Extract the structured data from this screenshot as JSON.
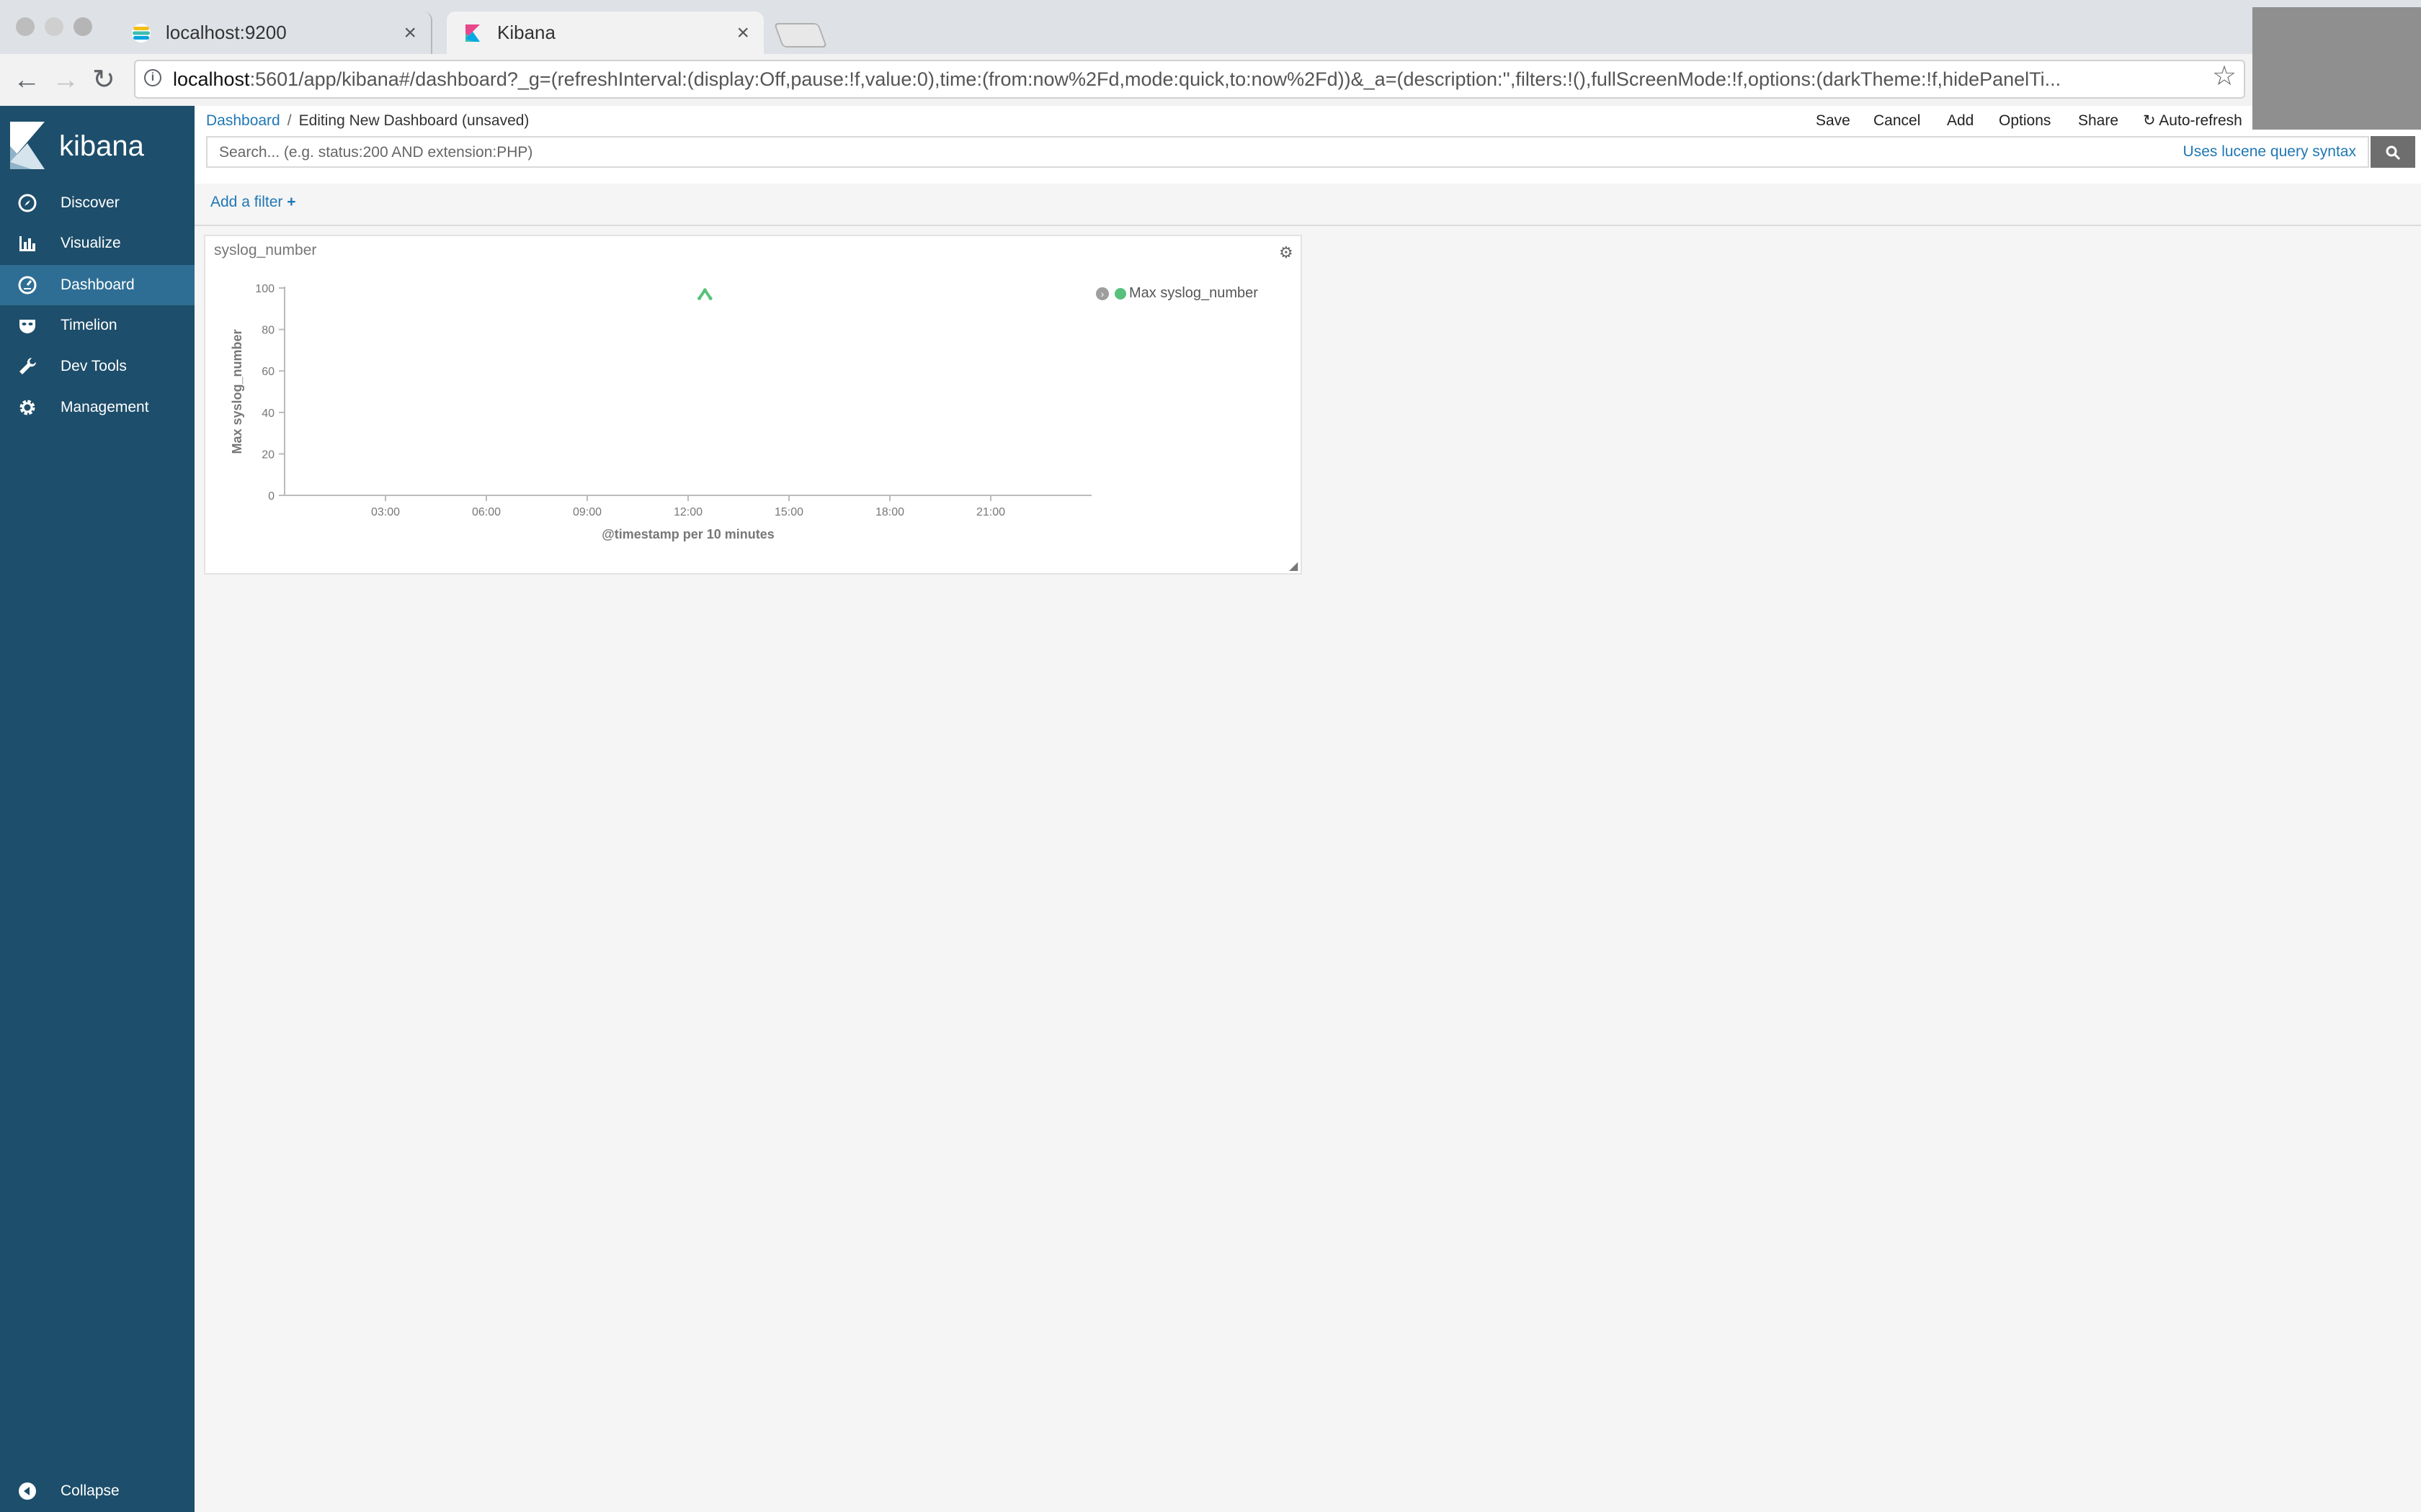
{
  "browser": {
    "tabs": [
      {
        "title": "localhost:9200",
        "active": false
      },
      {
        "title": "Kibana",
        "active": true
      }
    ],
    "url_host": "localhost",
    "url_rest": ":5601/app/kibana#/dashboard?_g=(refreshInterval:(display:Off,pause:!f,value:0),time:(from:now%2Fd,mode:quick,to:now%2Fd))&_a=(description:'',filters:!(),fullScreenMode:!f,options:(darkTheme:!f,hidePanelTi..."
  },
  "sidebar": {
    "brand": "kibana",
    "items": [
      {
        "label": "Discover",
        "icon": "compass-icon"
      },
      {
        "label": "Visualize",
        "icon": "bar-chart-icon"
      },
      {
        "label": "Dashboard",
        "icon": "dashboard-icon",
        "active": true
      },
      {
        "label": "Timelion",
        "icon": "timelion-mask-icon"
      },
      {
        "label": "Dev Tools",
        "icon": "wrench-icon"
      },
      {
        "label": "Management",
        "icon": "gear-icon"
      }
    ],
    "collapse_label": "Collapse"
  },
  "topbar": {
    "breadcrumb_root": "Dashboard",
    "breadcrumb_separator": "/",
    "breadcrumb_current": "Editing New Dashboard (unsaved)",
    "menu": {
      "save": "Save",
      "cancel": "Cancel",
      "add": "Add",
      "options": "Options",
      "share": "Share",
      "auto_refresh": "Auto-refresh"
    }
  },
  "search": {
    "placeholder": "Search... (e.g. status:200 AND extension:PHP)",
    "syntax_link": "Uses lucene query syntax"
  },
  "filter": {
    "add_label": "Add a filter",
    "add_symbol": "+"
  },
  "panel": {
    "title": "syslog_number"
  },
  "chart_data": {
    "type": "line",
    "title": "",
    "xlabel": "@timestamp per 10 minutes",
    "ylabel": "Max syslog_number",
    "x_ticks": [
      "03:00",
      "06:00",
      "09:00",
      "12:00",
      "15:00",
      "18:00",
      "21:00"
    ],
    "y_ticks": [
      0,
      20,
      40,
      60,
      80,
      100
    ],
    "ylim": [
      0,
      100
    ],
    "x_range_hours": [
      0,
      24
    ],
    "grid": false,
    "legend_position": "top-right",
    "series": [
      {
        "name": "Max syslog_number",
        "color": "#57c17b",
        "points": [
          {
            "x": "12:20",
            "y": 95
          },
          {
            "x": "12:30",
            "y": 99
          },
          {
            "x": "12:40",
            "y": 95
          }
        ]
      }
    ]
  },
  "colors": {
    "sidebar_bg": "#1d4e6b",
    "sidebar_active": "#2e6e94",
    "link": "#1f77b4",
    "series": "#57c17b"
  }
}
